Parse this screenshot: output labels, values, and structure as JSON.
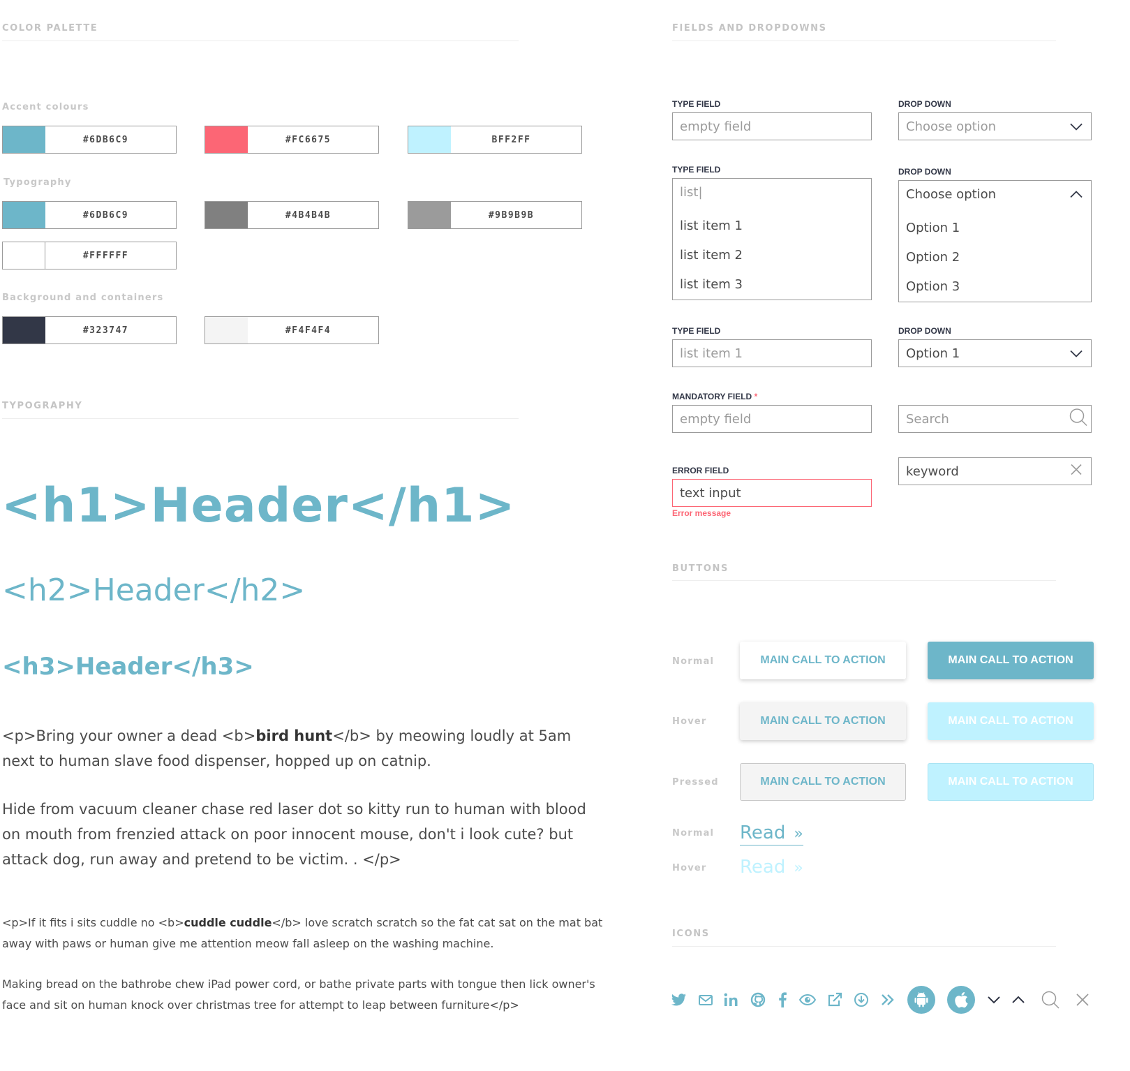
{
  "color_palette": {
    "title": "COLOR PALETTE",
    "accent": {
      "label": "Accent colours",
      "swatches": [
        {
          "hex": "#6DB6C9",
          "label": "#6DB6C9"
        },
        {
          "hex": "#FC6675",
          "label": "#FC6675"
        },
        {
          "hex": "#BFF2FF",
          "label": "BFF2FF"
        }
      ]
    },
    "typography": {
      "label": "Typography",
      "swatches": [
        {
          "hex": "#6DB6C9",
          "label": "#6DB6C9"
        },
        {
          "hex": "#808080",
          "label": "#4B4B4B"
        },
        {
          "hex": "#9B9B9B",
          "label": "#9B9B9B"
        },
        {
          "hex": "#FFFFFF",
          "label": "#FFFFFF"
        }
      ]
    },
    "background": {
      "label": "Background and containers",
      "swatches": [
        {
          "hex": "#323747",
          "label": "#323747"
        },
        {
          "hex": "#F4F4F4",
          "label": "#F4F4F4"
        }
      ]
    }
  },
  "typography": {
    "title": "TYPOGRAPHY",
    "h1": "<h1>Header</h1>",
    "h2": "<h2>Header</h2>",
    "h3": "<h3>Header</h3>",
    "p_large": {
      "open": "<p>Bring your owner a dead <b>",
      "bold": "bird hunt",
      "rest": "</b> by meowing loudly at 5am next to human slave food dispenser, hopped up on catnip.",
      "para2": "Hide from vacuum cleaner chase red laser dot so kitty run to human with blood on mouth from frenzied attack on poor innocent mouse, don't i look cute? but attack dog, run away and pretend to be victim. . </p>"
    },
    "p_small": {
      "open": "<p>If it fits i sits cuddle no <b>",
      "bold": "cuddle cuddle",
      "rest": "</b> love scratch scratch so the fat cat sat on the mat bat away with paws or human give me attention meow fall asleep on the washing machine.",
      "para2": "Making bread on the bathrobe chew iPad power cord, or bathe private parts with tongue then lick owner's face and sit on human knock over christmas tree for attempt to leap between furniture</p>"
    }
  },
  "fields": {
    "title": "FIELDS AND DROPDOWNS",
    "type_field_label": "TYPE FIELD",
    "drop_down_label": "DROP DOWN",
    "type1": {
      "placeholder": "empty field"
    },
    "drop1": {
      "placeholder": "Choose option"
    },
    "type2": {
      "value": "list|",
      "items": [
        "list item 1",
        "list item 2",
        "list item 3"
      ]
    },
    "drop2": {
      "value": "Choose option",
      "options": [
        "Option 1",
        "Option 2",
        "Option 3"
      ]
    },
    "type3": {
      "value": "list item 1"
    },
    "drop3": {
      "value": "Option 1"
    },
    "mandatory": {
      "label": "MANDATORY FIELD",
      "star": "*",
      "placeholder": "empty field"
    },
    "search": {
      "placeholder": "Search"
    },
    "error": {
      "label": "ERROR FIELD",
      "value": "text input",
      "message": "Error message"
    },
    "keyword": {
      "value": "keyword"
    }
  },
  "buttons": {
    "title": "BUTTONS",
    "states": {
      "normal": "Normal",
      "hover": "Hover",
      "pressed": "Pressed"
    },
    "cta": "MAIN CALL TO ACTION",
    "read": "Read",
    "read_arrow": "»"
  },
  "icons": {
    "title": "ICONS",
    "list": [
      "twitter-icon",
      "mail-icon",
      "linkedin-icon",
      "github-icon",
      "facebook-icon",
      "eye-icon",
      "external-link-icon",
      "download-icon",
      "double-chevron-right-icon",
      "android-icon",
      "apple-icon",
      "chevron-down-icon",
      "chevron-up-icon",
      "search-icon",
      "close-icon"
    ]
  },
  "colors": {
    "accent": "#6DB6C9",
    "alert": "#FC6675",
    "light_accent": "#BFF2FF",
    "text": "#4B4B4B",
    "muted": "#9B9B9B",
    "dark": "#323747",
    "bg": "#F4F4F4"
  }
}
